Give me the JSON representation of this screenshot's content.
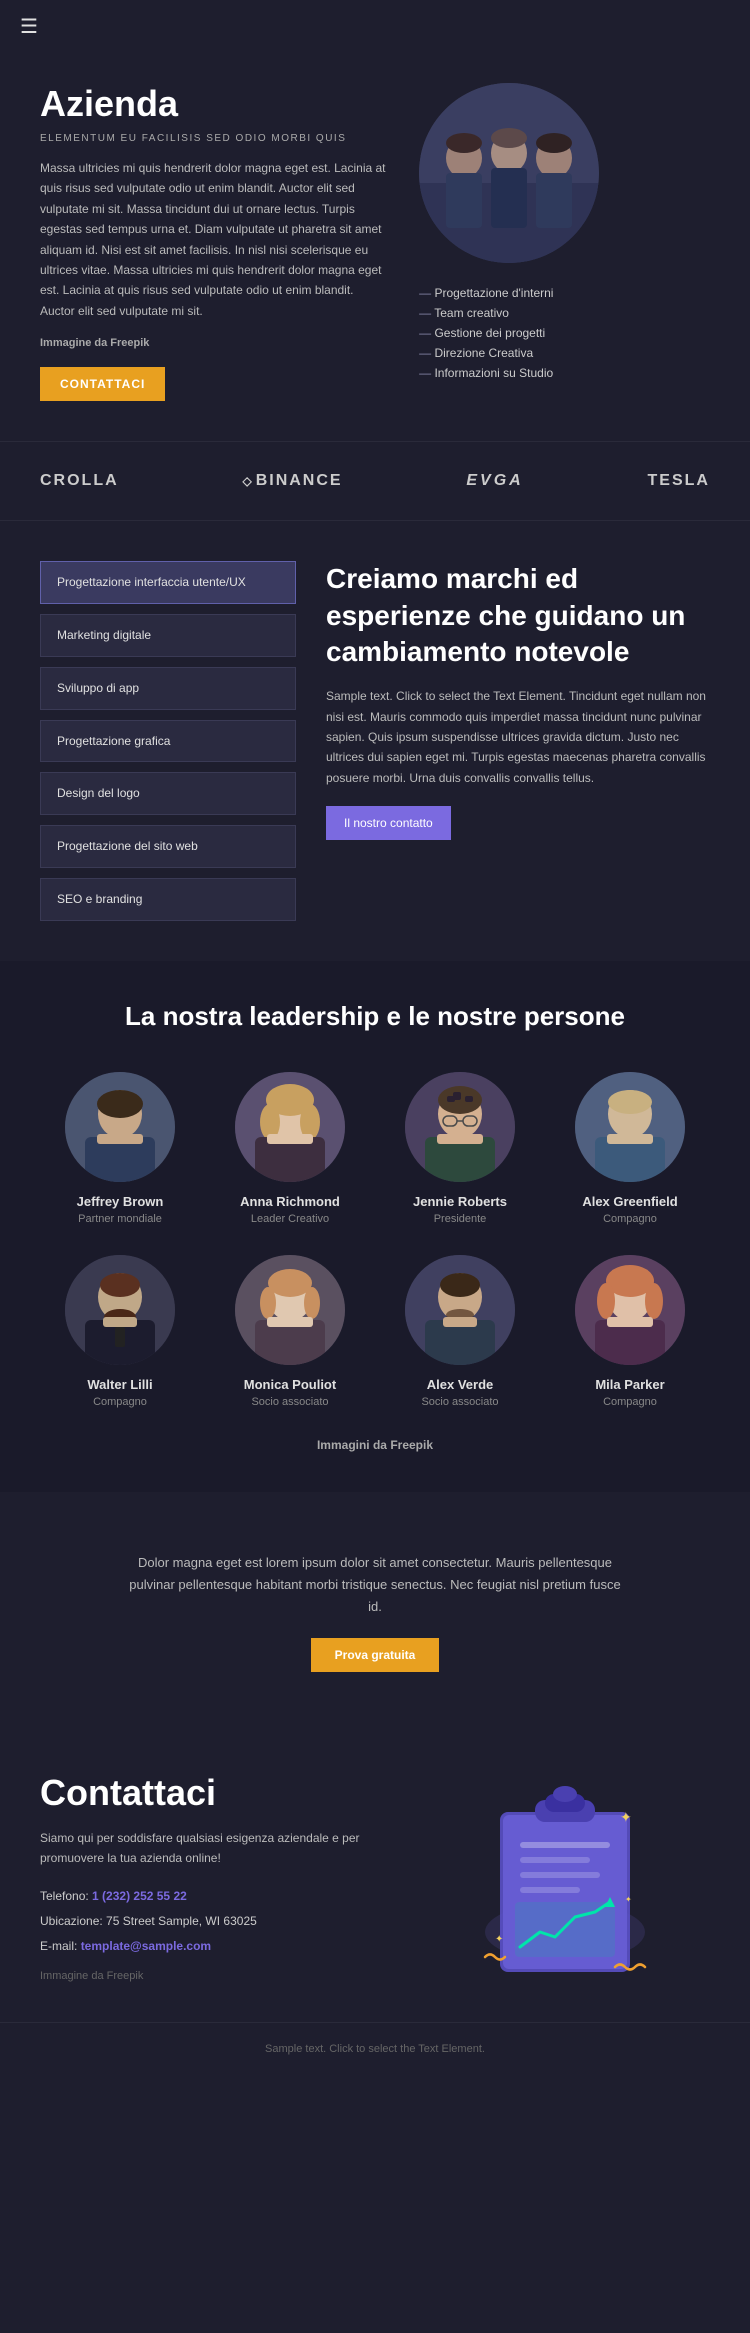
{
  "nav": {
    "menu_icon": "☰"
  },
  "hero": {
    "title": "Azienda",
    "subtitle": "ELEMENTUM EU FACILISIS SED ODIO MORBI QUIS",
    "description": "Massa ultricies mi quis hendrerit dolor magna eget est. Lacinia at quis risus sed vulputate odio ut enim blandit. Auctor elit sed vulputate mi sit. Massa tincidunt dui ut ornare lectus. Turpis egestas sed tempus urna et. Diam vulputate ut pharetra sit amet aliquam id. Nisi est sit amet facilisis. In nisl nisi scelerisque eu ultrices vitae. Massa ultricies mi quis hendrerit dolor magna eget est. Lacinia at quis risus sed vulputate odio ut enim blandit. Auctor elit sed vulputate mi sit.",
    "credit_prefix": "Immagine da ",
    "credit_brand": "Freepik",
    "button_label": "CONTATTACI",
    "list_items": [
      "Progettazione d'interni",
      "Team creativo",
      "Gestione dei progetti",
      "Direzione Creativa",
      "Informazioni su Studio"
    ]
  },
  "brands": {
    "items": [
      "CROLLA",
      "BINANCE",
      "EVGA",
      "TESLA"
    ]
  },
  "services": {
    "buttons": [
      {
        "label": "Progettazione interfaccia utente/UX",
        "active": true
      },
      {
        "label": "Marketing digitale",
        "active": false
      },
      {
        "label": "Sviluppo di app",
        "active": false
      },
      {
        "label": "Progettazione grafica",
        "active": false
      },
      {
        "label": "Design del logo",
        "active": false
      },
      {
        "label": "Progettazione del sito web",
        "active": false
      },
      {
        "label": "SEO e branding",
        "active": false
      }
    ],
    "heading": "Creiamo marchi ed esperienze che guidano un cambiamento notevole",
    "description": "Sample text. Click to select the Text Element. Tincidunt eget nullam non nisi est. Mauris commodo quis imperdiet massa tincidunt nunc pulvinar sapien. Quis ipsum suspendisse ultrices gravida dictum. Justo nec ultrices dui sapien eget mi. Turpis egestas maecenas pharetra convallis posuere morbi. Urna duis convallis convallis tellus.",
    "contact_label": "Il nostro contatto"
  },
  "leadership": {
    "title": "La nostra leadership e le nostre persone",
    "team_row1": [
      {
        "name": "Jeffrey Brown",
        "role": "Partner mondiale"
      },
      {
        "name": "Anna Richmond",
        "role": "Leader Creativo"
      },
      {
        "name": "Jennie Roberts",
        "role": "Presidente"
      },
      {
        "name": "Alex Greenfield",
        "role": "Compagno"
      }
    ],
    "team_row2": [
      {
        "name": "Walter Lilli",
        "role": "Compagno"
      },
      {
        "name": "Monica Pouliot",
        "role": "Socio associato"
      },
      {
        "name": "Alex Verde",
        "role": "Socio associato"
      },
      {
        "name": "Mila Parker",
        "role": "Compagno"
      }
    ],
    "credit_prefix": "Immagini da ",
    "credit_brand": "Freepik"
  },
  "cta": {
    "description": "Dolor magna eget est lorem ipsum dolor sit amet consectetur. Mauris pellentesque pulvinar pellentesque habitant morbi tristique senectus. Nec feugiat nisl pretium fusce id.",
    "button_label": "Prova gratuita"
  },
  "contact": {
    "title": "Contattaci",
    "description": "Siamo qui per soddisfare qualsiasi esigenza aziendale e per promuovere la tua azienda online!",
    "phone_label": "Telefono:",
    "phone_number": "1 (232) 252 55 22",
    "address_label": "Ubicazione:",
    "address_value": "75 Street Sample, WI 63025",
    "email_label": "E-mail:",
    "email_value": "template@sample.com",
    "credit": "Immagine da Freepik"
  },
  "footer": {
    "sample_text": "Sample text. Click to select the Text Element."
  },
  "colors": {
    "accent_yellow": "#e8a020",
    "accent_purple": "#7b6ae0",
    "bg_dark": "#1e1e2e",
    "bg_darker": "#1a1a2a",
    "text_light": "#ffffff",
    "text_muted": "#bbbbbb"
  }
}
